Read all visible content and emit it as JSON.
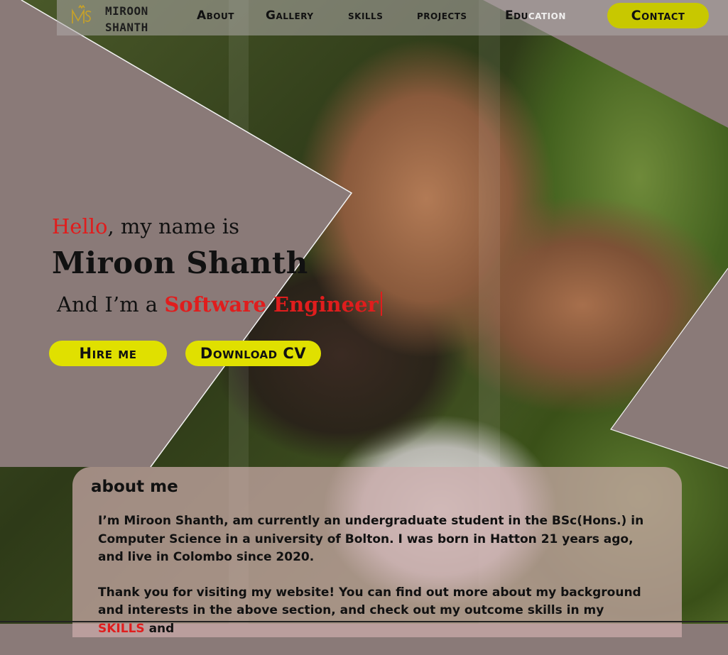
{
  "brand": {
    "line1": "MIROON",
    "line2": "SHANTH"
  },
  "nav": {
    "links": [
      "About",
      "Gallery",
      "skills",
      "projects",
      "Edu",
      "cation"
    ],
    "contact": "Contact"
  },
  "hero": {
    "greeting_highlight": "Hello",
    "greeting_rest": ", my name is",
    "name": "Miroon Shanth",
    "role_prefix": "And I’m a",
    "role_typed": "Software Engineer",
    "hire_button": "Hire me",
    "cv_button": "Download CV"
  },
  "about": {
    "title": "about me",
    "p1": "I’m Miroon Shanth, am currently an undergraduate student in the BSc(Hons.) in Computer Science  in a university of Bolton. I was born in Hatton 21 years ago, and live in Colombo since 2020.",
    "p2_start": "Thank you for visiting my website! You can find out more about my background and interests in the above section, and check out my outcome skills in my",
    "p2_highlight": "SKILLS",
    "p2_end": "and"
  },
  "colors": {
    "accent_red": "#e01d1d",
    "button_yellow": "#e0e000",
    "contact_yellow": "#c8c800",
    "overlay_gray": "#8a7a78"
  }
}
